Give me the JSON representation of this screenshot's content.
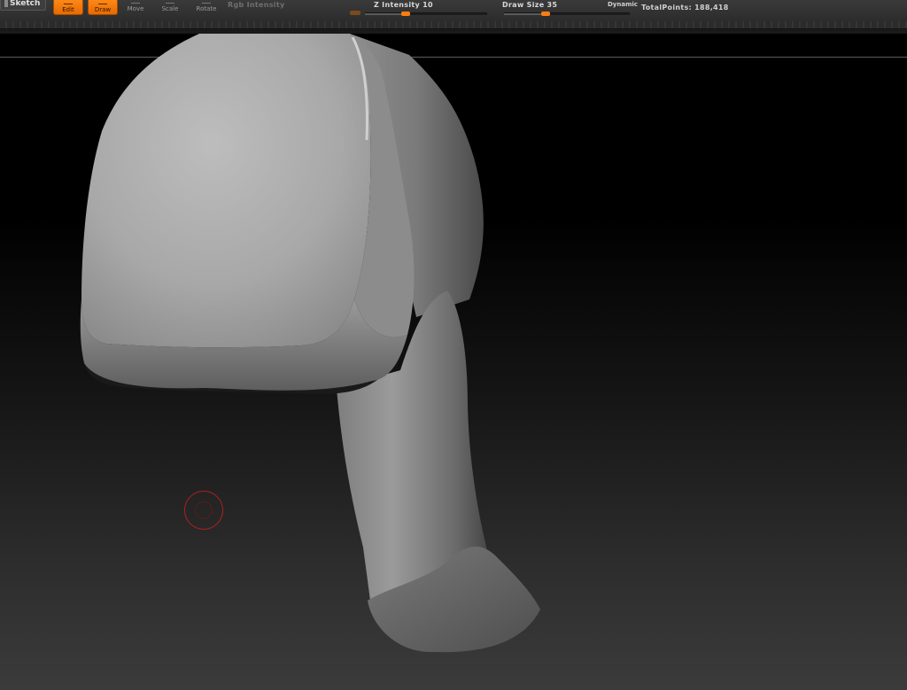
{
  "toolbar": {
    "sketch_label": "Sketch",
    "edit_label": "Edit",
    "draw_label": "Draw",
    "move_label": "Move",
    "scale_label": "Scale",
    "rotate_label": "Rotate",
    "rgb_intensity_label": "Rgb Intensity",
    "z_intensity_label": "Z Intensity 10",
    "draw_size_label": "Draw Size 35",
    "dynamic_label": "Dynamic",
    "total_points_label": "TotalPoints: 188,418",
    "z_intensity_value": 10,
    "z_intensity_max": 100,
    "draw_size_value": 35,
    "draw_size_max": 1000,
    "active_tools": [
      "edit",
      "draw"
    ]
  },
  "colors": {
    "accent": "#ff7d10",
    "toolbar_bg": "#2c2c2c",
    "cursor": "#b02020"
  },
  "icons": {
    "edit": "edit-icon",
    "draw": "draw-icon",
    "move": "move-icon",
    "scale": "scale-icon",
    "rotate": "rotate-icon",
    "brush_cursor": "brush-cursor-icon"
  }
}
